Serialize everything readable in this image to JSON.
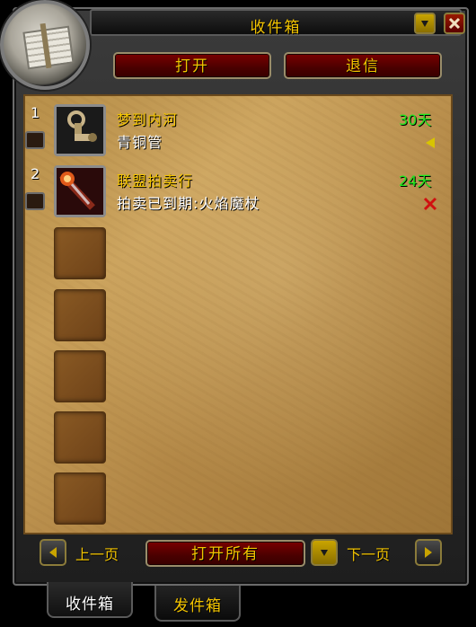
{
  "window": {
    "title": "收件箱"
  },
  "actions": {
    "open_label": "打开",
    "return_label": "退信"
  },
  "mail_items": [
    {
      "index": "1",
      "sender": "梦到内河",
      "subject": "青铜管",
      "days_left": "30天",
      "status_icon": "arrow-left-icon",
      "item_icon": "bronze-tube-icon"
    },
    {
      "index": "2",
      "sender": "联盟拍卖行",
      "subject": "拍卖已到期:火焰魔杖",
      "days_left": "24天",
      "status_icon": "red-x-icon",
      "item_icon": "fire-wand-icon"
    }
  ],
  "empty_slots": 5,
  "footer": {
    "prev_label": "上一页",
    "open_all_label": "打开所有",
    "next_label": "下一页"
  },
  "tabs": [
    {
      "label": "收件箱",
      "active": true
    },
    {
      "label": "发件箱",
      "active": false
    }
  ],
  "colors": {
    "gold": "#f3c400",
    "green_days": "#1ee81e",
    "button_red": "#6a0000"
  }
}
